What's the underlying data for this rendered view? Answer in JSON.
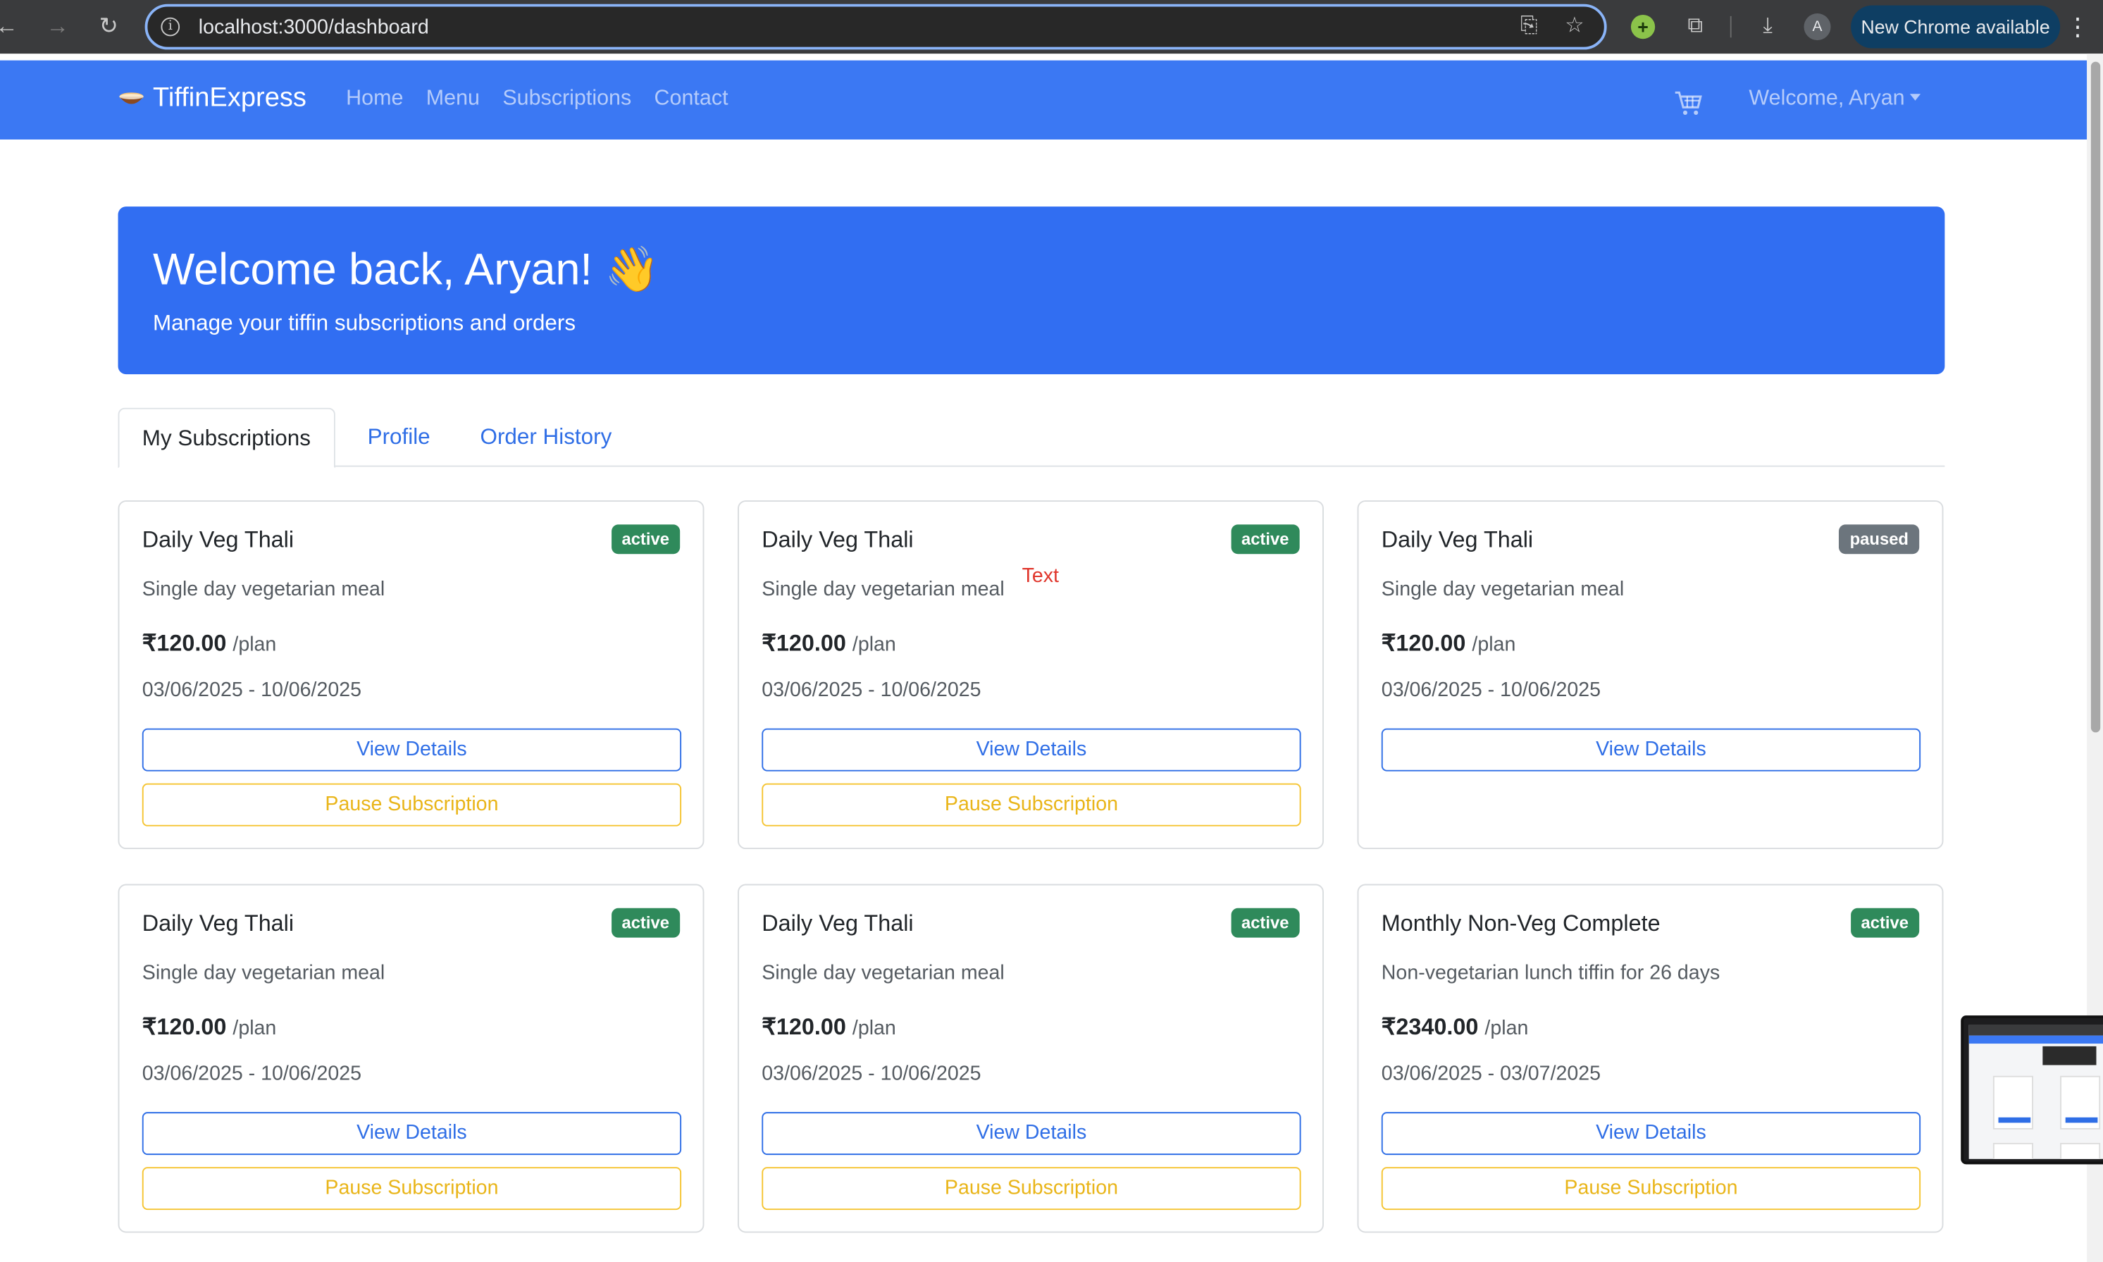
{
  "browser": {
    "url": "localhost:3000/dashboard",
    "update_label": "New Chrome available",
    "profile_initial": "A"
  },
  "navbar": {
    "brand": "TiffinExpress",
    "links": [
      "Home",
      "Menu",
      "Subscriptions",
      "Contact"
    ],
    "welcome": "Welcome, Aryan"
  },
  "hero": {
    "title": "Welcome back, Aryan! 👋",
    "subtitle": "Manage your tiffin subscriptions and orders",
    "color": "#316ef2"
  },
  "tabs": [
    {
      "label": "My Subscriptions",
      "active": true
    },
    {
      "label": "Profile",
      "active": false
    },
    {
      "label": "Order History",
      "active": false
    }
  ],
  "subscriptions": [
    {
      "title": "Daily Veg Thali",
      "status": "active",
      "description": "Single day vegetarian meal",
      "price": "₹120.00",
      "unit": "/plan",
      "dates": "03/06/2025 - 10/06/2025",
      "view_label": "View Details",
      "pause_label": "Pause Subscription"
    },
    {
      "title": "Daily Veg Thali",
      "status": "active",
      "description": "Single day vegetarian meal",
      "price": "₹120.00",
      "unit": "/plan",
      "dates": "03/06/2025 - 10/06/2025",
      "view_label": "View Details",
      "pause_label": "Pause Subscription",
      "stray_text": "Text"
    },
    {
      "title": "Daily Veg Thali",
      "status": "paused",
      "description": "Single day vegetarian meal",
      "price": "₹120.00",
      "unit": "/plan",
      "dates": "03/06/2025 - 10/06/2025",
      "view_label": "View Details"
    },
    {
      "title": "Daily Veg Thali",
      "status": "active",
      "description": "Single day vegetarian meal",
      "price": "₹120.00",
      "unit": "/plan",
      "dates": "03/06/2025 - 10/06/2025",
      "view_label": "View Details",
      "pause_label": "Pause Subscription"
    },
    {
      "title": "Daily Veg Thali",
      "status": "active",
      "description": "Single day vegetarian meal",
      "price": "₹120.00",
      "unit": "/plan",
      "dates": "03/06/2025 - 10/06/2025",
      "view_label": "View Details",
      "pause_label": "Pause Subscription"
    },
    {
      "title": "Monthly Non-Veg Complete",
      "status": "active",
      "description": "Non-vegetarian lunch tiffin for 26 days",
      "price": "₹2340.00",
      "unit": "/plan",
      "dates": "03/06/2025 - 03/07/2025",
      "view_label": "View Details",
      "pause_label": "Pause Subscription"
    }
  ],
  "colors": {
    "navbar": "#3b78f3",
    "primary": "#2f6ee6",
    "warning": "#f5c431",
    "badge_active": "#2f8a5b",
    "badge_paused": "#6c757d"
  }
}
